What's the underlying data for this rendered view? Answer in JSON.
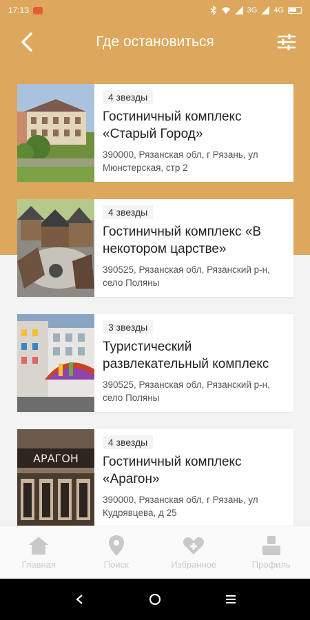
{
  "status_bar": {
    "time": "17:13",
    "network_1": "3G",
    "network_2": "4G"
  },
  "header": {
    "title": "Где остановиться",
    "back_icon": "chevron-left-icon",
    "filter_icon": "sliders-icon"
  },
  "hotels": [
    {
      "stars": "4 звезды",
      "name": "Гостиничный комплекс «Старый Город»",
      "address": "390000, Рязанская обл, г Рязань, ул Мюнстерская, стр 2"
    },
    {
      "stars": "4 звезды",
      "name": "Гостиничный комплекс «В некотором царстве»",
      "address": "390525, Рязанская обл, Рязанский р-н, село Поляны"
    },
    {
      "stars": "3 звезды",
      "name": "Туристический развлекательный комплекс",
      "address": "390525, Рязанская обл, Рязанский р-н, село Поляны"
    },
    {
      "stars": "4 звезды",
      "name": "Гостиничный комплекс «Арагон»",
      "address": "390000, Рязанская обл, г Рязань, ул Кудрявцева, д 25",
      "sign_text": "АРАГОН"
    }
  ],
  "bottom_nav": [
    {
      "label": "Главная",
      "icon": "home-icon"
    },
    {
      "label": "Поиск",
      "icon": "map-pin-icon"
    },
    {
      "label": "Избранное",
      "icon": "heart-icon"
    },
    {
      "label": "Профиль",
      "icon": "user-icon"
    }
  ],
  "colors": {
    "accent": "#dda85d",
    "inactive_nav": "#c9c9c9"
  }
}
